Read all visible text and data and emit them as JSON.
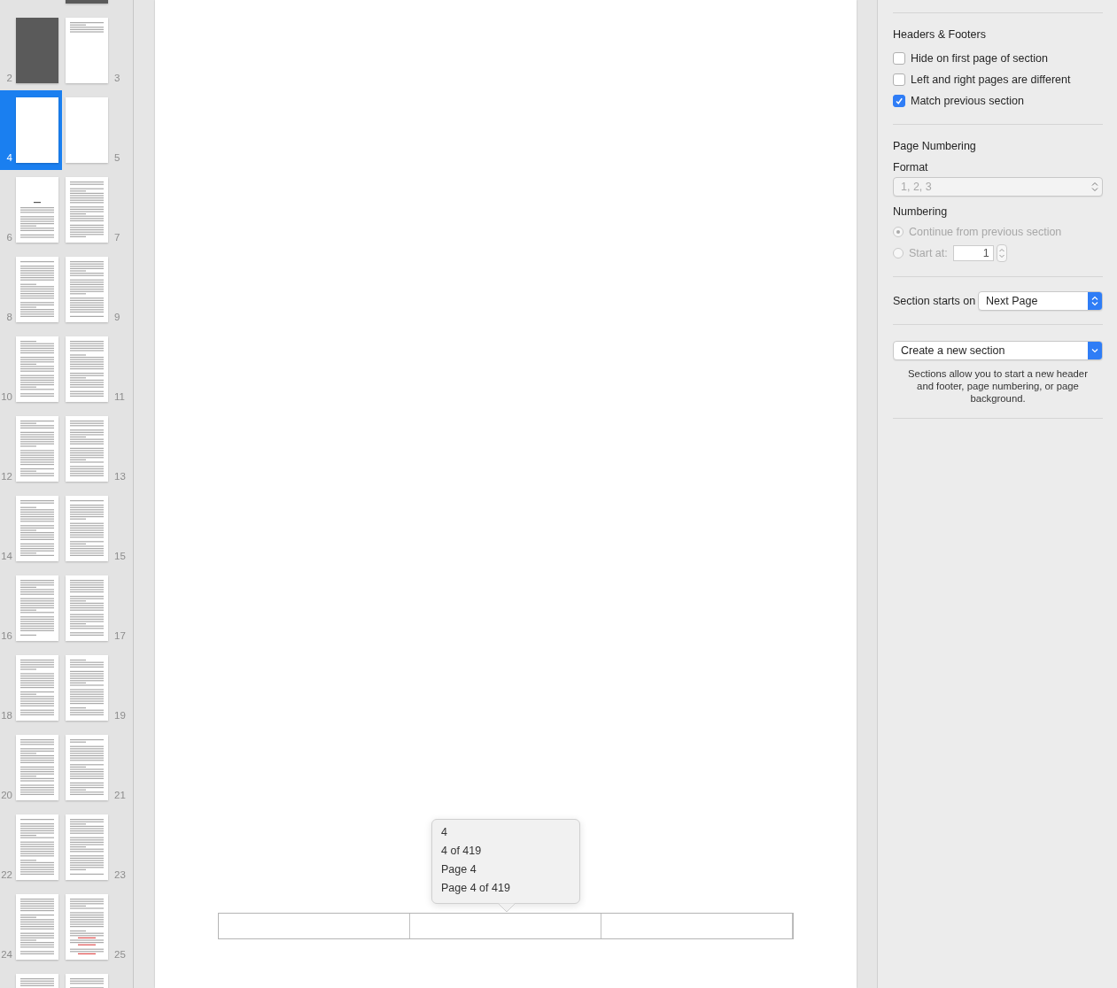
{
  "thumbnails": [
    {
      "kind": "dark"
    },
    {
      "number": "2",
      "kind": "dark",
      "selected": false
    },
    {
      "number": "3",
      "kind": "short",
      "selected": false
    },
    {
      "number": "4",
      "kind": "blank",
      "selected": true
    },
    {
      "number": "5",
      "kind": "blank",
      "selected": false
    },
    {
      "number": "6",
      "kind": "title",
      "selected": false
    },
    {
      "number": "7",
      "kind": "text",
      "selected": false
    },
    {
      "number": "8",
      "kind": "text",
      "selected": false
    },
    {
      "number": "9",
      "kind": "text",
      "selected": false
    },
    {
      "number": "10",
      "kind": "text",
      "selected": false
    },
    {
      "number": "11",
      "kind": "text",
      "selected": false
    },
    {
      "number": "12",
      "kind": "text",
      "selected": false
    },
    {
      "number": "13",
      "kind": "text",
      "selected": false
    },
    {
      "number": "14",
      "kind": "text",
      "selected": false
    },
    {
      "number": "15",
      "kind": "text",
      "selected": false
    },
    {
      "number": "16",
      "kind": "text",
      "selected": false
    },
    {
      "number": "17",
      "kind": "text",
      "selected": false
    },
    {
      "number": "18",
      "kind": "text",
      "selected": false
    },
    {
      "number": "19",
      "kind": "text",
      "selected": false
    },
    {
      "number": "20",
      "kind": "text",
      "selected": false
    },
    {
      "number": "21",
      "kind": "text",
      "selected": false
    },
    {
      "number": "22",
      "kind": "text",
      "selected": false
    },
    {
      "number": "23",
      "kind": "text",
      "selected": false
    },
    {
      "number": "24",
      "kind": "text",
      "selected": false
    },
    {
      "number": "25",
      "kind": "mixed",
      "selected": false
    },
    {
      "kind": "text"
    },
    {
      "kind": "text"
    }
  ],
  "footer_popup": {
    "options": [
      "4",
      "4 of 419",
      "Page 4",
      "Page 4 of 419"
    ]
  },
  "inspector": {
    "headers_footers": {
      "title": "Headers & Footers",
      "options": [
        {
          "label": "Hide on first page of section",
          "checked": false
        },
        {
          "label": "Left and right pages are different",
          "checked": false
        },
        {
          "label": "Match previous section",
          "checked": true
        }
      ]
    },
    "page_numbering": {
      "title": "Page Numbering",
      "format_label": "Format",
      "format_value": "1, 2, 3",
      "numbering_label": "Numbering",
      "disabled": true,
      "choices": [
        {
          "label": "Continue from previous section",
          "selected": true,
          "kind": "radio"
        },
        {
          "label": "Start at:",
          "selected": false,
          "kind": "radio-with-field",
          "value": "1"
        }
      ]
    },
    "section_starts": {
      "label": "Section starts on",
      "value": "Next Page"
    },
    "new_section": {
      "value": "Create a new section",
      "note": "Sections allow you to start a new header and footer, page numbering, or page background."
    }
  }
}
